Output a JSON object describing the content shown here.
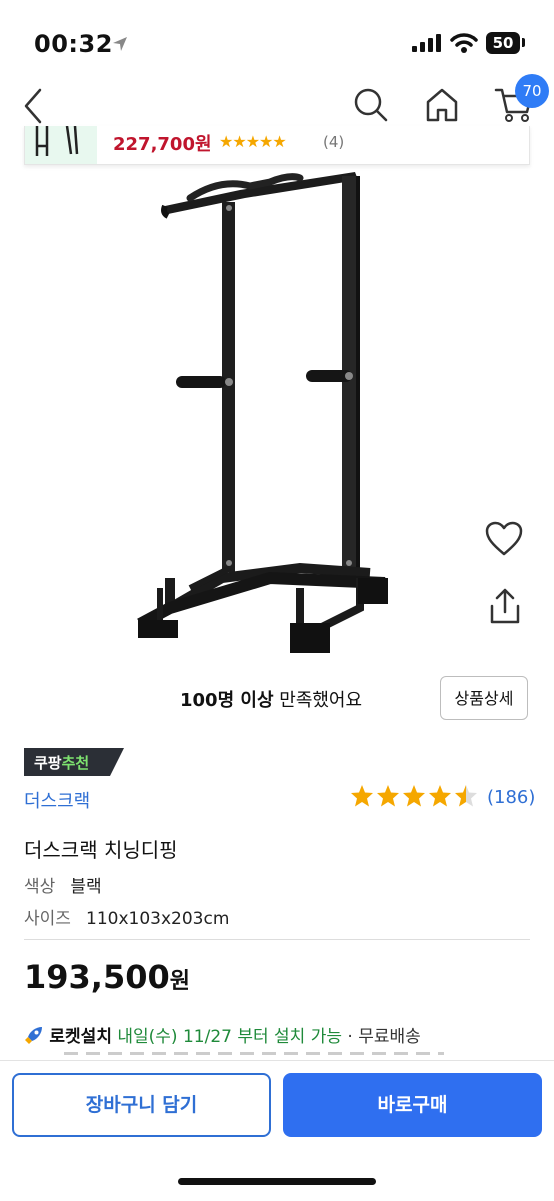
{
  "status_bar": {
    "time": "00:32",
    "battery": "50"
  },
  "nav": {
    "cart_count": "70"
  },
  "promo": {
    "price": "227,700원",
    "rating_count": "(4)"
  },
  "satisfaction": {
    "bold": "100명 이상",
    "rest": " 만족했어요"
  },
  "detail_button": "상품상세",
  "badge": {
    "part1": "쿠팡",
    "part2": "추천"
  },
  "brand": "더스크랙",
  "rating": {
    "value": 4.5,
    "count": "(186)"
  },
  "product_title": "더스크랙 치닝디핑",
  "options": [
    {
      "label": "색상",
      "value": "블랙"
    },
    {
      "label": "사이즈",
      "value": "110x103x203cm"
    }
  ],
  "price": {
    "amount": "193,500",
    "unit": "원"
  },
  "delivery": {
    "rocket": "로켓설치",
    "schedule": " 내일(수) 11/27 부터 설치 가능",
    "shipping": " · 무료배송"
  },
  "buttons": {
    "add_to_cart": "장바구니 담기",
    "buy_now": "바로구매"
  },
  "colors": {
    "accent_blue": "#2f6ff0",
    "rating_star": "#f5a700",
    "promo_red": "#c0152d",
    "green": "#1f8a3a"
  }
}
